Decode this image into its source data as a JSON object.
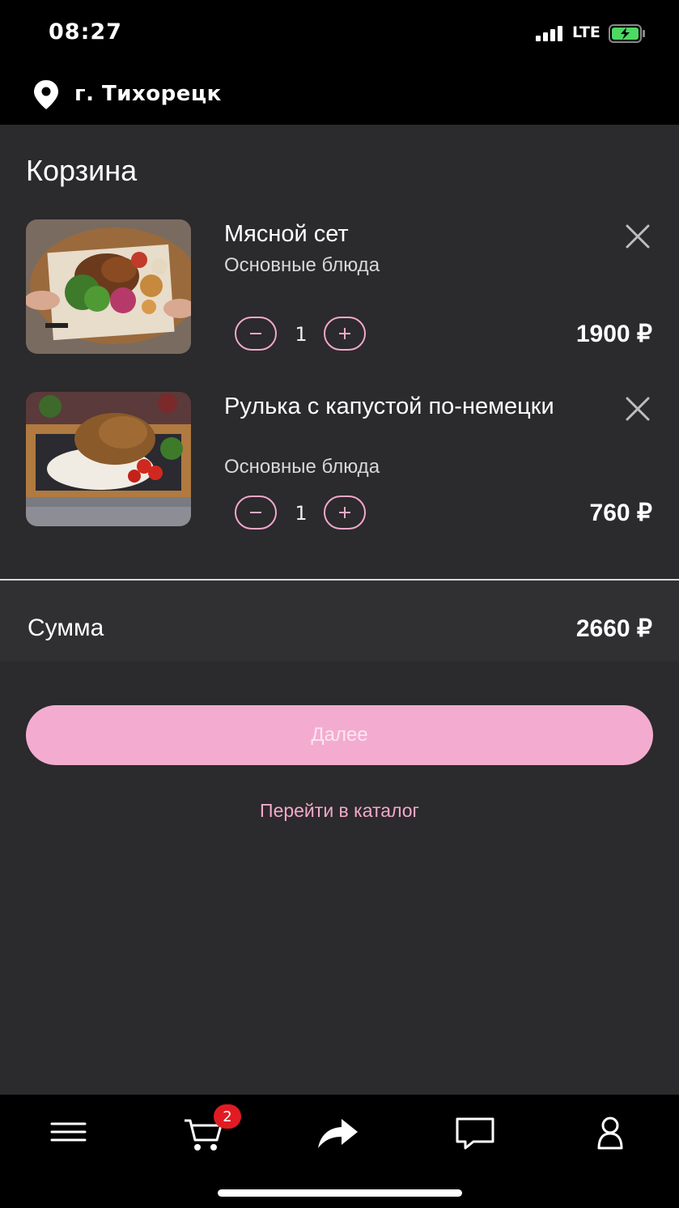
{
  "status_bar": {
    "time": "08:27",
    "network": "LTE"
  },
  "header": {
    "city": "г. Тихорецк"
  },
  "page": {
    "title": "Корзина"
  },
  "cart": {
    "items": [
      {
        "name": "Мясной сет",
        "category": "Основные блюда",
        "quantity": "1",
        "price": "1900 ₽",
        "image": "meat-platter-photo"
      },
      {
        "name": "Рулька с капустой по-немецки",
        "category": "Основные блюда",
        "quantity": "1",
        "price": "760 ₽",
        "image": "pork-knuckle-photo"
      }
    ],
    "sum_label": "Сумма",
    "sum_value": "2660 ₽"
  },
  "actions": {
    "next_label": "Далее",
    "catalog_link": "Перейти в каталог"
  },
  "tab_bar": {
    "cart_badge": "2",
    "icons": [
      "menu-icon",
      "cart-icon",
      "share-icon",
      "chat-icon",
      "profile-icon"
    ]
  },
  "colors": {
    "accent": "#f3a8c9",
    "button": "#f3acd0",
    "background": "#2b2a2c",
    "badge": "#e11b22"
  }
}
